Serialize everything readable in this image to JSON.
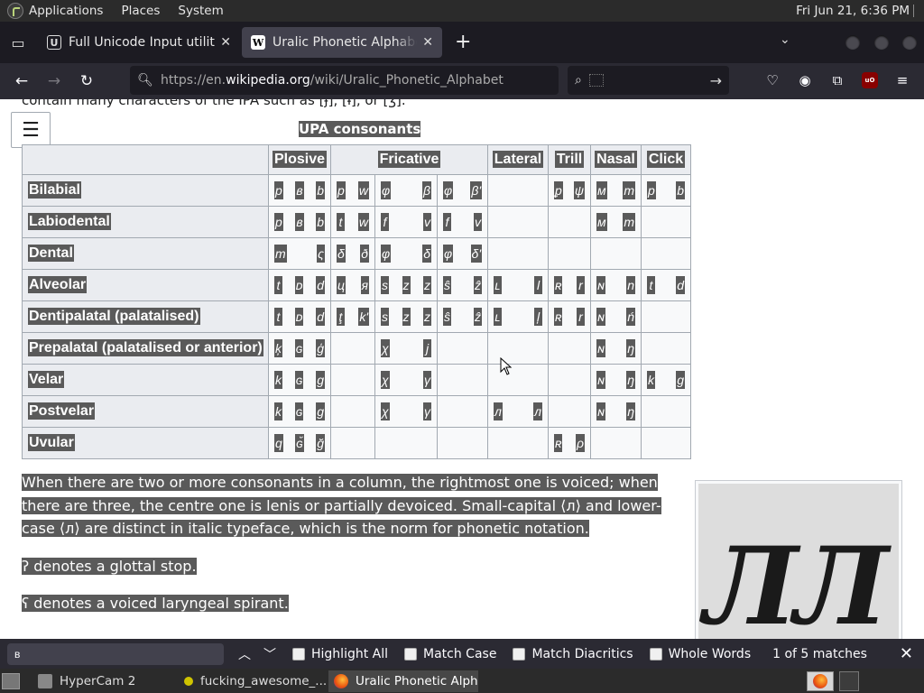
{
  "panel": {
    "applications": "Applications",
    "places": "Places",
    "system": "System",
    "clock": "Fri Jun 21,  6:36 PM"
  },
  "tabs": [
    {
      "title": "Full Unicode Input utility",
      "favicon": "U"
    },
    {
      "title": "Uralic Phonetic Alphabet - Wikipedia",
      "favicon": "W"
    }
  ],
  "nav": {
    "url_prefix": "https://en.",
    "url_host": "wikipedia.org",
    "url_path": "/wiki/Uralic_Phonetic_Alphabet",
    "search_placeholder": ""
  },
  "article": {
    "top_line": "contain many characters of the IPA such as [ɟ], [ɨ], or [ʒ].",
    "table_caption": "UPA consonants",
    "headers": [
      "",
      "Plosive",
      "Fricative",
      "Lateral",
      "Trill",
      "Nasal",
      "Click"
    ],
    "rows": [
      {
        "label": "Bilabial",
        "plosive": [
          "p",
          "ʙ",
          "b"
        ],
        "fric": [
          [
            "p",
            "w"
          ],
          [
            "φ",
            "",
            "β"
          ],
          [
            "φ",
            "β'"
          ]
        ],
        "lateral": [],
        "trill": [
          "ᵱ",
          "ψ"
        ],
        "nasal": [
          "ᴍ",
          "m"
        ],
        "click": [
          "p",
          "b"
        ]
      },
      {
        "label": "Labiodental",
        "plosive": [
          "p",
          "ʙ",
          "b"
        ],
        "fric": [
          [
            "t",
            "w"
          ],
          [
            "f",
            "",
            "v"
          ],
          [
            "f",
            "v"
          ]
        ],
        "lateral": [],
        "trill": [],
        "nasal": [
          "ᴍ",
          "m"
        ],
        "click": []
      },
      {
        "label": "Dental",
        "plosive": [
          "т",
          "",
          "ς"
        ],
        "fric": [
          [
            "δ",
            "ð"
          ],
          [
            "φ",
            "",
            "δ"
          ],
          [
            "φ",
            "δ'"
          ]
        ],
        "lateral": [],
        "trill": [],
        "nasal": [],
        "click": []
      },
      {
        "label": "Alveolar",
        "plosive": [
          "t",
          "ᴅ",
          "d"
        ],
        "fric": [
          [
            "ц",
            "я"
          ],
          [
            "s",
            "z",
            "z"
          ],
          [
            "ŝ",
            "ẑ"
          ]
        ],
        "lateral": [
          "ʟ",
          "l"
        ],
        "trill": [
          "ʀ",
          "r"
        ],
        "nasal": [
          "ɴ",
          "n"
        ],
        "click": [
          "t",
          "d"
        ]
      },
      {
        "label": "Dentipalatal (palatalised)",
        "plosive": [
          "t",
          "ᴅ",
          "d"
        ],
        "fric": [
          [
            "ţ",
            "k'"
          ],
          [
            "s",
            "z",
            "z"
          ],
          [
            "ŝ",
            "ẑ"
          ]
        ],
        "lateral": [
          "ʟ",
          "ļ"
        ],
        "trill": [
          "ʀ",
          "r"
        ],
        "nasal": [
          "ɴ",
          "ń"
        ],
        "click": []
      },
      {
        "label": "Prepalatal (palatalised or anterior)",
        "plosive": [
          "ķ",
          "ɢ",
          "ģ"
        ],
        "fric": [
          [
            "",
            ""
          ],
          [
            "χ",
            "",
            "j"
          ],
          [
            "",
            ""
          ]
        ],
        "lateral": [],
        "trill": [],
        "nasal": [
          "ɴ",
          "ŋ"
        ],
        "click": []
      },
      {
        "label": "Velar",
        "plosive": [
          "k",
          "ɢ",
          "g"
        ],
        "fric": [
          [
            "",
            ""
          ],
          [
            "χ",
            "",
            "γ"
          ],
          [
            "",
            ""
          ]
        ],
        "lateral": [],
        "trill": [],
        "nasal": [
          "ɴ",
          "ŋ"
        ],
        "click": [
          "k",
          "g"
        ]
      },
      {
        "label": "Postvelar",
        "plosive": [
          "k",
          "ɢ",
          "g"
        ],
        "fric": [
          [
            "",
            ""
          ],
          [
            "χ",
            "",
            "γ"
          ],
          [
            "",
            ""
          ]
        ],
        "lateral": [
          "ᴫ",
          "л"
        ],
        "trill": [],
        "nasal": [
          "ɴ",
          "ŋ"
        ],
        "click": []
      },
      {
        "label": "Uvular",
        "plosive": [
          "q",
          "ɢ̆",
          "ğ"
        ],
        "fric": [
          [
            "",
            ""
          ],
          [
            "",
            "",
            ""
          ],
          [
            "",
            ""
          ]
        ],
        "lateral": [],
        "trill": [
          "ʀ",
          "ρ"
        ],
        "nasal": [],
        "click": []
      }
    ],
    "para1": "When there are two or more consonants in a column, the rightmost one is voiced; when there are three, the centre one is lenis or partially devoiced. Small-capital ⟨ᴫ⟩ and lower-case ⟨л⟩ are distinct in italic typeface, which is the norm for phonetic notation.",
    "para2": "ʔ denotes a glottal stop.",
    "para3": "ʕ denotes a voiced laryngeal spirant.",
    "figure_glyph": "ЛЛ"
  },
  "findbar": {
    "query": "ʙ",
    "highlight_all": "Highlight All",
    "match_case": "Match Case",
    "match_diacritics": "Match Diacritics",
    "whole_words": "Whole Words",
    "count": "1 of 5 matches"
  },
  "taskbar": [
    {
      "label": "HyperCam 2"
    },
    {
      "label": "fucking_awesome_..."
    },
    {
      "label": "Uralic Phonetic Alph..."
    }
  ],
  "colors": {
    "selection": "#5a5a5a",
    "tab_active": "#42414d",
    "toolbar": "#2b2a33"
  }
}
